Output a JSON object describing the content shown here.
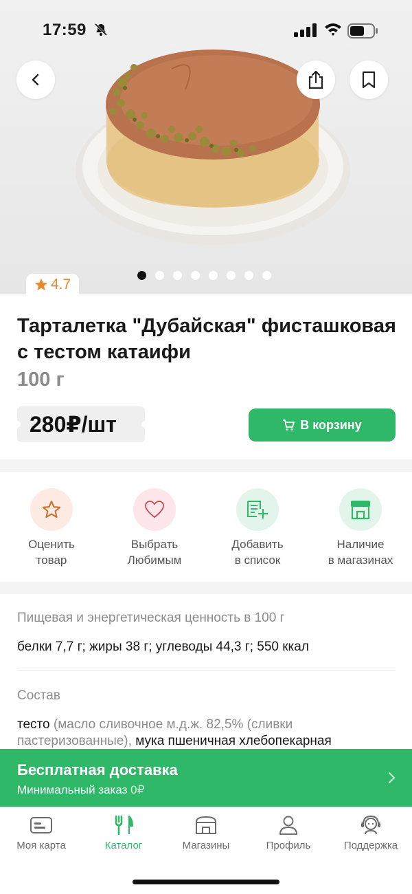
{
  "status": {
    "time": "17:59"
  },
  "product": {
    "rating": "4.7",
    "title": "Тарталетка \"Дубайская\" фисташковая с тестом катаифи",
    "weight": "100 г",
    "price": "280₽/шт",
    "cart_label": "В корзину",
    "image_count": 8,
    "active_image": 1
  },
  "actions": [
    {
      "line1": "Оценить",
      "line2": "товар",
      "icon": "star-icon",
      "bg": "#fdebe3"
    },
    {
      "line1": "Выбрать",
      "line2": "Любимым",
      "icon": "heart-icon",
      "bg": "#fce6ea"
    },
    {
      "line1": "Добавить",
      "line2": "в список",
      "icon": "list-add-icon",
      "bg": "#e3f5ea"
    },
    {
      "line1": "Наличие",
      "line2": "в магазинах",
      "icon": "store-icon",
      "bg": "#e3f5ea"
    }
  ],
  "nutrition": {
    "title": "Пищевая и энергетическая ценность в 100 г",
    "value": "белки 7,7 г; жиры 38 г; углеводы 44,3 г; 550 ккал"
  },
  "composition": {
    "title": "Состав",
    "part1": "тесто",
    "part2": " (масло сливочное м.д.ж. 82,5% (сливки пастеризованные), ",
    "part3": "мука пшеничная хлебопекарная"
  },
  "delivery": {
    "title": "Бесплатная доставка",
    "min_label": "Минимальный заказ",
    "min_value": "0₽"
  },
  "tabs": [
    {
      "label": "Моя карта",
      "icon": "card-icon"
    },
    {
      "label": "Каталог",
      "icon": "catalog-icon",
      "active": true
    },
    {
      "label": "Магазины",
      "icon": "store-icon"
    },
    {
      "label": "Профиль",
      "icon": "profile-icon"
    },
    {
      "label": "Поддержка",
      "icon": "support-icon"
    }
  ],
  "colors": {
    "brand_green": "#2fb868",
    "rating_orange": "#e8892b",
    "muted_text": "#8c8c8c"
  }
}
